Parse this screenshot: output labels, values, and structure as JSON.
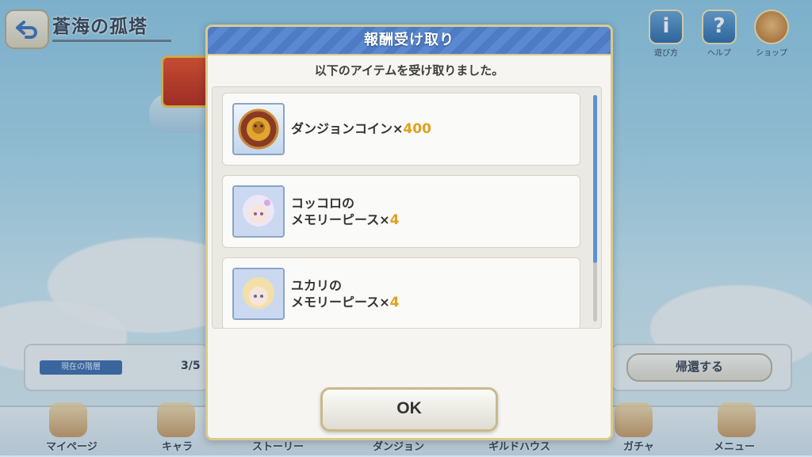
{
  "header": {
    "title": "蒼海の孤塔",
    "icons": [
      {
        "name": "info-icon",
        "label": "遊び方"
      },
      {
        "name": "help-icon",
        "label": "ヘルプ"
      },
      {
        "name": "shop-icon",
        "label": "ショップ"
      }
    ]
  },
  "background": {
    "progress_label": "現在の階層",
    "progress_value": "3/5",
    "return_label": "帰還する"
  },
  "bottom_nav": [
    "マイページ",
    "キャラ",
    "ストーリー",
    "ダンジョン",
    "ギルドハウス",
    "ガチャ",
    "メニュー"
  ],
  "modal": {
    "title": "報酬受け取り",
    "subtitle": "以下のアイテムを受け取りました。",
    "rewards": [
      {
        "line1": "ダンジョンコイン×",
        "line2": "",
        "qty": "400",
        "icon": "dungeon-coin-icon"
      },
      {
        "line1": "コッコロの",
        "line2": "メモリーピース×",
        "qty": "4",
        "icon": "kokkoro-portrait"
      },
      {
        "line1": "ユカリの",
        "line2": "メモリーピース×",
        "qty": "4",
        "icon": "yukari-portrait"
      }
    ],
    "ok_label": "OK"
  },
  "colors": {
    "accent": "#4e7bc4",
    "gold": "#e0a020",
    "frame": "#d9c98e"
  }
}
